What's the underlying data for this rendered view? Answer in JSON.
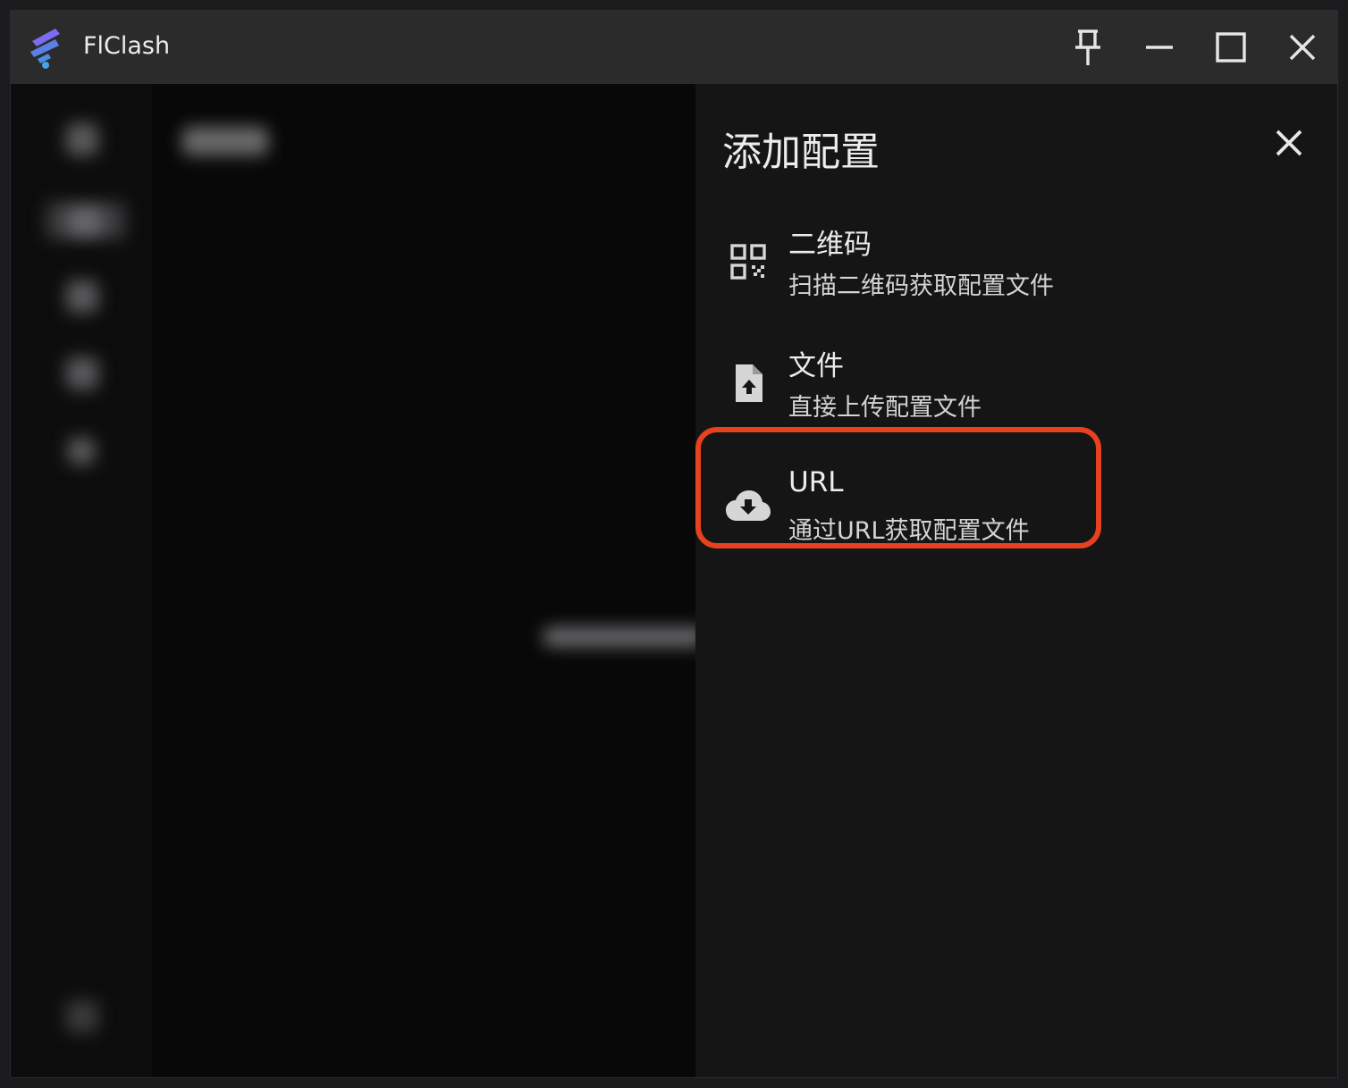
{
  "window": {
    "app_title": "FlClash",
    "controls": {
      "pin": "pin-icon",
      "minimize": "minimize-icon",
      "maximize": "maximize-icon",
      "close": "close-icon"
    }
  },
  "drawer": {
    "title": "添加配置",
    "close_icon": "close-icon",
    "options": [
      {
        "icon": "qr-code-icon",
        "title": "二维码",
        "subtitle": "扫描二维码获取配置文件"
      },
      {
        "icon": "file-upload-icon",
        "title": "文件",
        "subtitle": "直接上传配置文件"
      },
      {
        "icon": "cloud-download-icon",
        "title": "URL",
        "subtitle": "通过URL获取配置文件"
      }
    ]
  },
  "colors": {
    "highlight": "#e8411f",
    "drawer_bg": "#151516",
    "titlebar_bg": "#2b2b2c"
  }
}
